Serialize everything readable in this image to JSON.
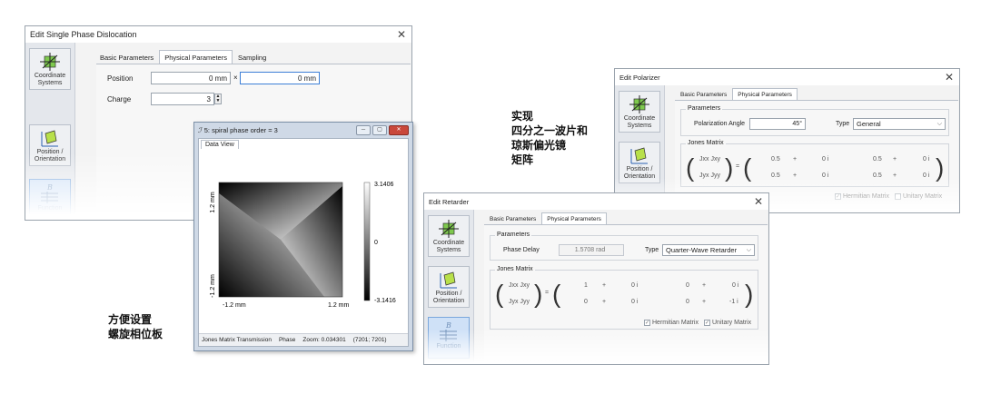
{
  "spiral_dialog": {
    "title": "Edit Single Phase Dislocation",
    "tabs": [
      "Basic Parameters",
      "Physical Parameters",
      "Sampling"
    ],
    "position_label": "Position",
    "position_x": "0 mm",
    "position_sep": "×",
    "position_y": "0 mm",
    "charge_label": "Charge",
    "charge_value": "3",
    "sidebar": [
      "Coordinate Systems",
      "Position / Orientation",
      "Function"
    ]
  },
  "data_view": {
    "title": "5: spiral phase order = 3",
    "tab": "Data View",
    "y_axis_top": "1.2 mm",
    "y_axis_bottom": "-1.2 mm",
    "x_axis_left": "-1.2 mm",
    "x_axis_right": "1.2 mm",
    "colorbar_max": "3.1406",
    "colorbar_mid": "0",
    "colorbar_min": "-3.1416",
    "status": [
      "Jones Matrix Transmission",
      "Phase",
      "Zoom: 0.034301",
      "(7201; 7201)"
    ]
  },
  "polarizer_dialog": {
    "title": "Edit Polarizer",
    "tabs": [
      "Basic Parameters",
      "Physical Parameters"
    ],
    "group_parameters": "Parameters",
    "angle_label": "Polarization Angle",
    "angle_value": "45°",
    "type_label": "Type",
    "type_value": "General",
    "group_jones": "Jones Matrix",
    "jxx_jxy": "Jxx  Jxy",
    "jyx_jyy": "Jyx  Jyy",
    "eq": "=",
    "row1": [
      "0.5",
      "+",
      "0 i",
      "0.5",
      "+",
      "0 i"
    ],
    "row2": [
      "0.5",
      "+",
      "0 i",
      "0.5",
      "+",
      "0 i"
    ],
    "hermitian": "Hermitian Matrix",
    "unitary": "Unitary Matrix",
    "sidebar": [
      "Coordinate Systems",
      "Position / Orientation"
    ]
  },
  "retarder_dialog": {
    "title": "Edit Retarder",
    "tabs": [
      "Basic Parameters",
      "Physical Parameters"
    ],
    "group_parameters": "Parameters",
    "delay_label": "Phase Delay",
    "delay_value": "1.5708 rad",
    "type_label": "Type",
    "type_value": "Quarter-Wave Retarder",
    "group_jones": "Jones Matrix",
    "jxx_jxy": "Jxx  Jxy",
    "jyx_jyy": "Jyx  Jyy",
    "eq": "=",
    "row1": [
      "1",
      "+",
      "0 i",
      "0",
      "+",
      "0 i"
    ],
    "row2": [
      "0",
      "+",
      "0 i",
      "0",
      "+",
      "-1 i"
    ],
    "hermitian": "Hermitian Matrix",
    "unitary": "Unitary Matrix",
    "sidebar": [
      "Coordinate Systems",
      "Position / Orientation",
      "Function"
    ]
  },
  "annotations": {
    "bottom_left": "方便设置\n螺旋相位板",
    "top_right": "实现\n四分之一波片和\n琼斯偏光镜\n矩阵"
  }
}
